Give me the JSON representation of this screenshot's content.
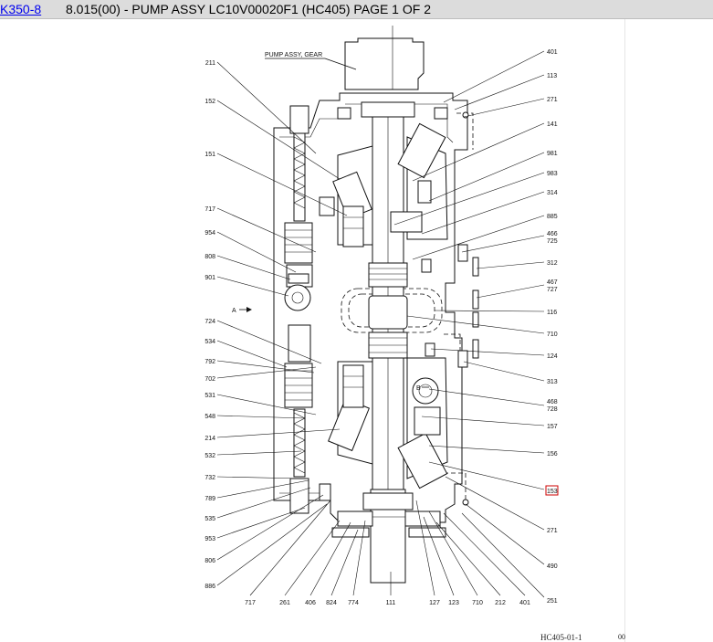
{
  "header": {
    "link_label": "K350-8",
    "title": "8.015(00) - PUMP ASSY LC10V00020F1 (HC405) PAGE 1 OF 2"
  },
  "drawing": {
    "note": "PUMP ASSY, GEAR",
    "arrow_a_label": "A",
    "arrow_b_label": "B",
    "left_callouts": [
      "211",
      "152",
      "151",
      "717",
      "954",
      "808",
      "901",
      "724",
      "534",
      "792",
      "702",
      "531",
      "548",
      "214",
      "532",
      "732",
      "789",
      "535",
      "953",
      "806",
      "886"
    ],
    "right_callouts": [
      "401",
      "113",
      "271",
      "141",
      "981",
      "983",
      "314",
      "885",
      "466",
      "725",
      "312",
      "467",
      "727",
      "116",
      "710",
      "124",
      "313",
      "468",
      "728",
      "157",
      "156",
      "153",
      "271",
      "490",
      "251"
    ],
    "bottom_callouts": [
      "717",
      "261",
      "406",
      "824",
      "774",
      "111",
      "127",
      "123",
      "710",
      "212",
      "401"
    ],
    "highlighted_callout": "153",
    "highlight_color": "#cc0000",
    "drawing_id": "HC405-01-1",
    "page_code": "00"
  }
}
